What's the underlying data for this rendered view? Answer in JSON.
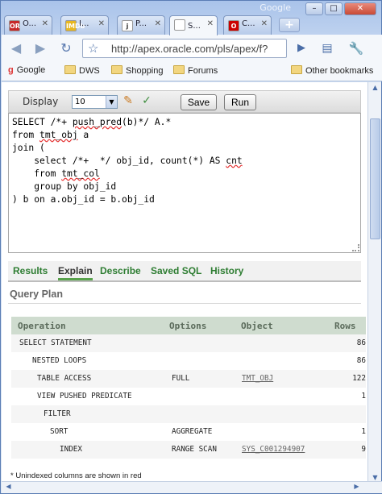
{
  "browser": {
    "brand": "Google",
    "window_buttons": [
      "–",
      "□",
      "✕"
    ],
    "tabs": [
      {
        "title": "O...",
        "fav": "OR",
        "fav_color": "#c62828",
        "active": false
      },
      {
        "title": "I...",
        "fav": "IMDb",
        "fav_color": "#e7b720",
        "active": false
      },
      {
        "title": "P...",
        "fav": "j",
        "fav_color": "#ffffff",
        "active": false
      },
      {
        "title": "S...",
        "fav": "",
        "fav_color": "#ffffff",
        "active": true
      },
      {
        "title": "C...",
        "fav": "O",
        "fav_color": "#cc0000",
        "active": false
      }
    ],
    "url": "http://apex.oracle.com/pls/apex/f?",
    "bookmarks": [
      "Google",
      "DWS",
      "Shopping",
      "Forums",
      "Other bookmarks"
    ]
  },
  "editor": {
    "display_label": "Display",
    "rows_value": "10",
    "save_label": "Save",
    "run_label": "Run",
    "sql_lines": [
      "SELECT /*+ push_pred(b)*/ A.*",
      "from tmt_obj a",
      "join (",
      "    select /*+  */ obj_id, count(*) AS cnt",
      "    from tmt_col",
      "    group by obj_id",
      ") b on a.obj_id = b.obj_id"
    ]
  },
  "result_tabs": [
    "Results",
    "Explain",
    "Describe",
    "Saved SQL",
    "History"
  ],
  "active_result_tab": "Explain",
  "query_plan": {
    "title": "Query Plan",
    "columns": [
      "Operation",
      "Options",
      "Object",
      "Rows"
    ],
    "rows": [
      {
        "operation": "SELECT STATEMENT",
        "indent": 0,
        "options": "",
        "object": "",
        "rows": "86"
      },
      {
        "operation": "NESTED LOOPS",
        "indent": 1,
        "options": "",
        "object": "",
        "rows": "86"
      },
      {
        "operation": "TABLE ACCESS",
        "indent": 2,
        "options": "FULL",
        "object": "TMT_OBJ",
        "rows": "122"
      },
      {
        "operation": "VIEW PUSHED PREDICATE",
        "indent": 2,
        "options": "",
        "object": "",
        "rows": "1"
      },
      {
        "operation": "FILTER",
        "indent": 3,
        "options": "",
        "object": "",
        "rows": ""
      },
      {
        "operation": "SORT",
        "indent": 4,
        "options": "AGGREGATE",
        "object": "",
        "rows": "1"
      },
      {
        "operation": "INDEX",
        "indent": 5,
        "options": "RANGE SCAN",
        "object": "SYS_C001294907",
        "rows": "9"
      }
    ],
    "footnote": "* Unindexed columns are shown in red"
  }
}
